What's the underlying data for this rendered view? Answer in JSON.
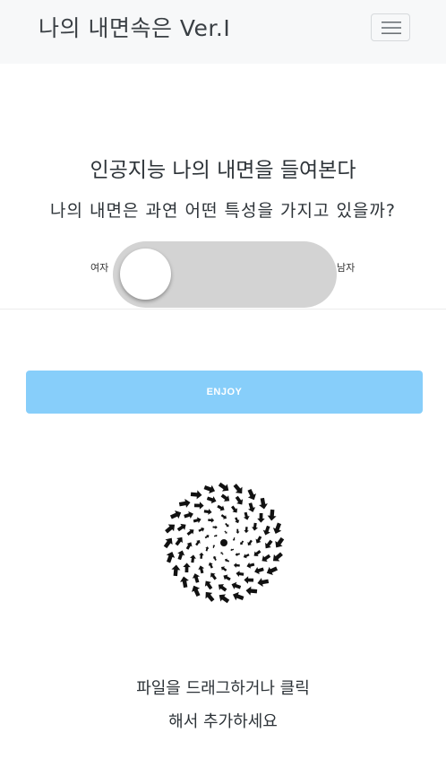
{
  "navbar": {
    "brand": "나의 내면속은 Ver.I",
    "menu_icon": "hamburger-menu-icon"
  },
  "hero": {
    "headline": "인공지능 나의 내면을 들여본다",
    "subline": "나의 내면은 과연 어떤 특성을 가지고 있을까?"
  },
  "gender_switch": {
    "left_label": "여자",
    "right_label": "남자",
    "state": "여자"
  },
  "action": {
    "enjoy_label": "ENJOY",
    "color": "#87cefa"
  },
  "upload": {
    "icon": "spiral-arrows-icon",
    "line1": "파일을 드래그하거나 클릭",
    "line2": "해서 추가하세요"
  }
}
